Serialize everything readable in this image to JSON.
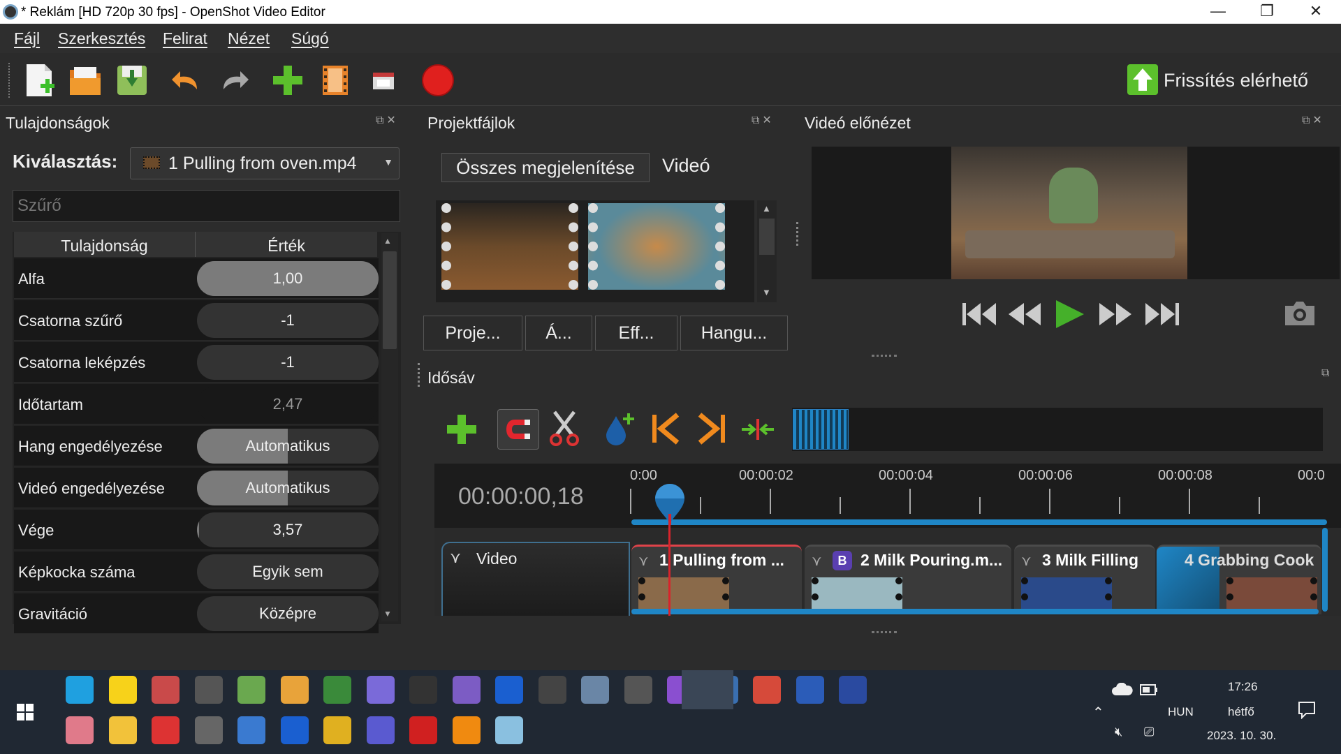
{
  "window": {
    "title": "* Reklám [HD 720p 30 fps] - OpenShot Video Editor",
    "minimize": "—",
    "maximize": "❐",
    "close": "✕"
  },
  "menu": [
    "Fájl",
    "Szerkesztés",
    "Felirat",
    "Nézet",
    "Súgó"
  ],
  "toolbar": {
    "update_label": "Frissítés elérhető"
  },
  "properties": {
    "title": "Tulajdonságok",
    "select_label": "Kiválasztás:",
    "selected": "1 Pulling from oven.mp4",
    "filter_placeholder": "Szűrő",
    "col_name": "Tulajdonság",
    "col_value": "Érték",
    "rows": [
      {
        "name": "Alfa",
        "value": "1,00",
        "fill": 1.0
      },
      {
        "name": "Csatorna szűrő",
        "value": "-1",
        "fill": 0
      },
      {
        "name": "Csatorna leképzés",
        "value": "-1",
        "fill": 0
      },
      {
        "name": "Időtartam",
        "value": "2,47",
        "fill": 0
      },
      {
        "name": "Hang engedélyezése",
        "value": "Automatikus",
        "fill": 0.5
      },
      {
        "name": "Videó engedélyezése",
        "value": "Automatikus",
        "fill": 0.5
      },
      {
        "name": "Vége",
        "value": "3,57",
        "fill": 0.01
      },
      {
        "name": "Képkocka száma",
        "value": "Egyik sem",
        "fill": 0
      },
      {
        "name": "Gravitáció",
        "value": "Középre",
        "fill": 0
      }
    ]
  },
  "project_files": {
    "title": "Projektfájlok",
    "filter_all": "Összes megjelenítése",
    "filter_video": "Videó",
    "tabs": [
      "Proje...",
      "Á...",
      "Eff...",
      "Hangu..."
    ]
  },
  "preview": {
    "title": "Videó előnézet"
  },
  "timeline": {
    "title": "Idősáv",
    "timecode": "00:00:00,18",
    "ruler": [
      "0:00",
      "00:00:02",
      "00:00:04",
      "00:00:06",
      "00:00:08",
      "00:0"
    ],
    "track_name": "Video",
    "clips": [
      {
        "label": "1 Pulling from ..."
      },
      {
        "label": "2 Milk Pouring.m...",
        "badge": "B"
      },
      {
        "label": "3 Milk Filling"
      },
      {
        "label": "4 Grabbing Cook"
      }
    ]
  },
  "taskbar": {
    "lang": "HUN",
    "time": "17:26",
    "day": "hétfő",
    "date": "2023. 10. 30."
  },
  "colors": {
    "accent_blue": "#1f86c6",
    "playhead": "#d9232b",
    "clip_selected": "#e0434a",
    "record": "#e0201e",
    "play": "#45b02a"
  }
}
